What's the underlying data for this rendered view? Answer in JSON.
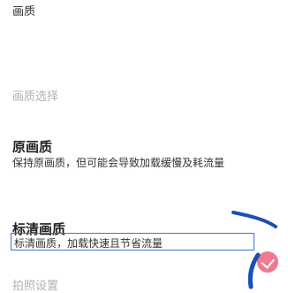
{
  "header": {
    "title": "画质"
  },
  "sections": [
    {
      "title": "画质选择"
    },
    {
      "title": "拍照设置"
    }
  ],
  "items": [
    {
      "title": "原画质",
      "description": "保持原画质，但可能会导致加载缓慢及耗流量"
    },
    {
      "title": "标清画质",
      "description": "标清画质，加载快速且节省流量"
    }
  ],
  "colors": {
    "accent": "#f07a8e",
    "highlight_border": "#3b73e0",
    "section_title": "#b0b0b0"
  },
  "icons": {
    "selected": "checkmark-icon",
    "pointer": "pointer-stroke-icon"
  }
}
